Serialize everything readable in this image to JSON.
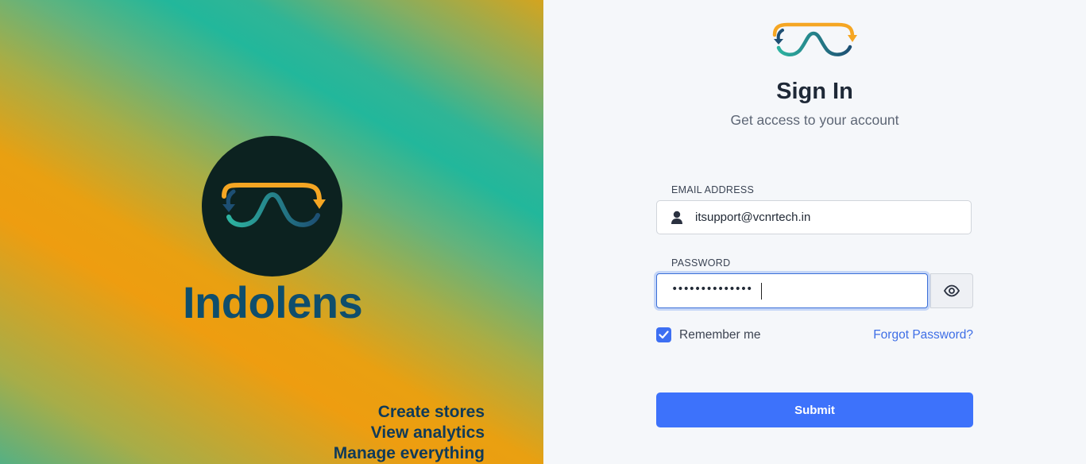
{
  "brand": {
    "name": "Indolens",
    "taglines": [
      "Create stores",
      "View analytics",
      "Manage everything"
    ]
  },
  "signin": {
    "title": "Sign In",
    "subtitle": "Get access to your account",
    "email_label": "EMAIL ADDRESS",
    "email_value": "itsupport@vcnrtech.in",
    "password_label": "PASSWORD",
    "password_masked": "••••••••••••••",
    "remember_label": "Remember me",
    "remember_checked": true,
    "forgot_label": "Forgot Password?",
    "submit_label": "Submit"
  },
  "icons": {
    "logo": "indolens-logo-icon",
    "user": "user-icon",
    "eye": "eye-icon",
    "check": "check-icon"
  },
  "colors": {
    "accent": "#3d72fb",
    "brand_dark": "#0c2220",
    "brand_text": "#0f4e6c",
    "logo_orange": "#f5a623",
    "logo_teal": "#2db3a0",
    "logo_navy": "#1d4f73"
  }
}
